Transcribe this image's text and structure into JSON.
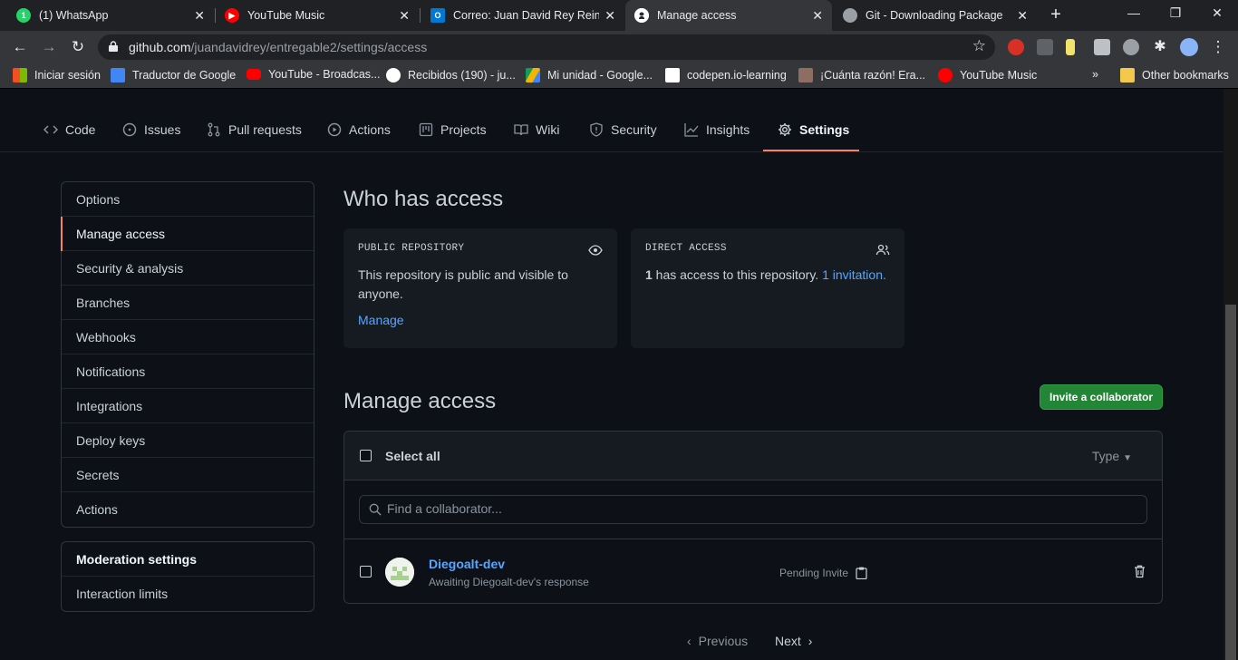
{
  "browser": {
    "tabs": [
      {
        "title": "(1) WhatsApp",
        "icon": "whatsapp-icon",
        "color": "#25d366",
        "badge": "1"
      },
      {
        "title": "YouTube Music",
        "icon": "youtube-music-icon",
        "color": "#ff0000"
      },
      {
        "title": "Correo: Juan David Rey Reina -",
        "icon": "outlook-icon",
        "color": "#0078d4"
      },
      {
        "title": "Manage access",
        "icon": "github-icon",
        "color": "#ffffff"
      },
      {
        "title": "Git - Downloading Package",
        "icon": "globe-icon",
        "color": "#9aa0a6"
      }
    ],
    "url_host": "github.com",
    "url_path": "/juandavidrey/entregable2/settings/access",
    "bookmarks": [
      {
        "label": "Iniciar sesión",
        "icon": "microsoft-icon"
      },
      {
        "label": "Traductor de Google",
        "icon": "translate-icon"
      },
      {
        "label": "YouTube - Broadcas...",
        "icon": "youtube-icon"
      },
      {
        "label": "Recibidos (190) - ju...",
        "icon": "google-icon"
      },
      {
        "label": "Mi unidad - Google...",
        "icon": "drive-icon"
      },
      {
        "label": "codepen.io-learning",
        "icon": "codepen-icon"
      },
      {
        "label": "¡Cuánta razón! Era...",
        "icon": "image-icon"
      },
      {
        "label": "YouTube Music",
        "icon": "youtube-music-icon"
      }
    ],
    "more": "»",
    "other_bookmarks": "Other bookmarks"
  },
  "repo_nav": {
    "tabs": [
      "Code",
      "Issues",
      "Pull requests",
      "Actions",
      "Projects",
      "Wiki",
      "Security",
      "Insights",
      "Settings"
    ],
    "selected": "Settings"
  },
  "sidebar": {
    "items": [
      "Options",
      "Manage access",
      "Security & analysis",
      "Branches",
      "Webhooks",
      "Notifications",
      "Integrations",
      "Deploy keys",
      "Secrets",
      "Actions"
    ],
    "selected": "Manage access",
    "moderation_heading": "Moderation settings",
    "moderation_items": [
      "Interaction limits"
    ]
  },
  "who_has_access": {
    "heading": "Who has access",
    "public_box": {
      "label": "PUBLIC REPOSITORY",
      "text": "This repository is public and visible to anyone.",
      "link": "Manage"
    },
    "direct_box": {
      "label": "DIRECT ACCESS",
      "count": "1",
      "text": " has access to this repository. ",
      "link": "1 invitation."
    }
  },
  "manage_access": {
    "heading": "Manage access",
    "invite_button": "Invite a collaborator",
    "select_all": "Select all",
    "type_filter": "Type",
    "search_placeholder": "Find a collaborator...",
    "collaborators": [
      {
        "name": "Diegoalt-dev",
        "subtitle": "Awaiting Diegoalt-dev's response",
        "status": "Pending Invite"
      }
    ],
    "pagination": {
      "previous": "Previous",
      "next": "Next"
    }
  }
}
